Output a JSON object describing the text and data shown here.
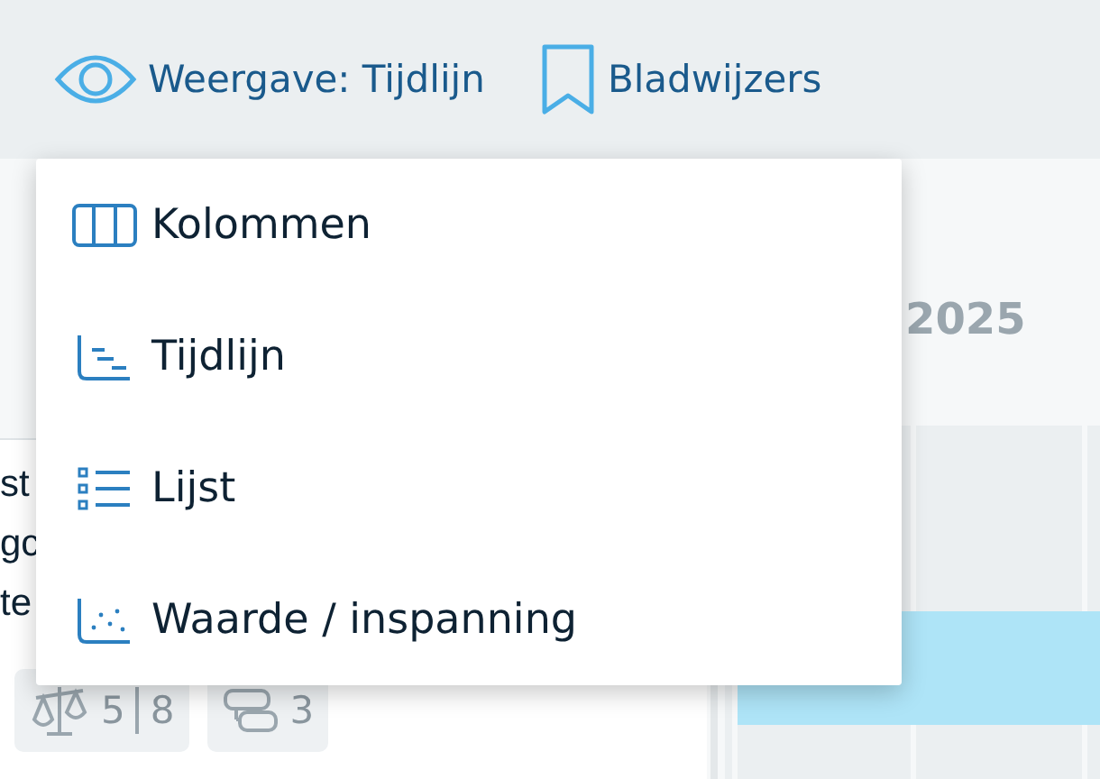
{
  "toolbar": [
    {
      "kind": "view",
      "label": "Weergave: Tijdlijn"
    },
    {
      "kind": "bookmarks",
      "label": "Bladwijzers"
    }
  ],
  "menu": {
    "items": [
      {
        "kind": "columns",
        "label": "Kolommen"
      },
      {
        "kind": "timeline",
        "label": "Tijdlijn"
      },
      {
        "kind": "list",
        "label": "Lijst"
      },
      {
        "kind": "scatter",
        "label": "Waarde / inspanning"
      }
    ]
  },
  "card": {
    "lines": [
      "st",
      "gc",
      "te"
    ],
    "badges": [
      {
        "kind": "estimate",
        "values": [
          "5",
          "8"
        ]
      },
      {
        "kind": "comments",
        "values": [
          "3"
        ]
      }
    ]
  },
  "timeline": {
    "year": "2025"
  }
}
